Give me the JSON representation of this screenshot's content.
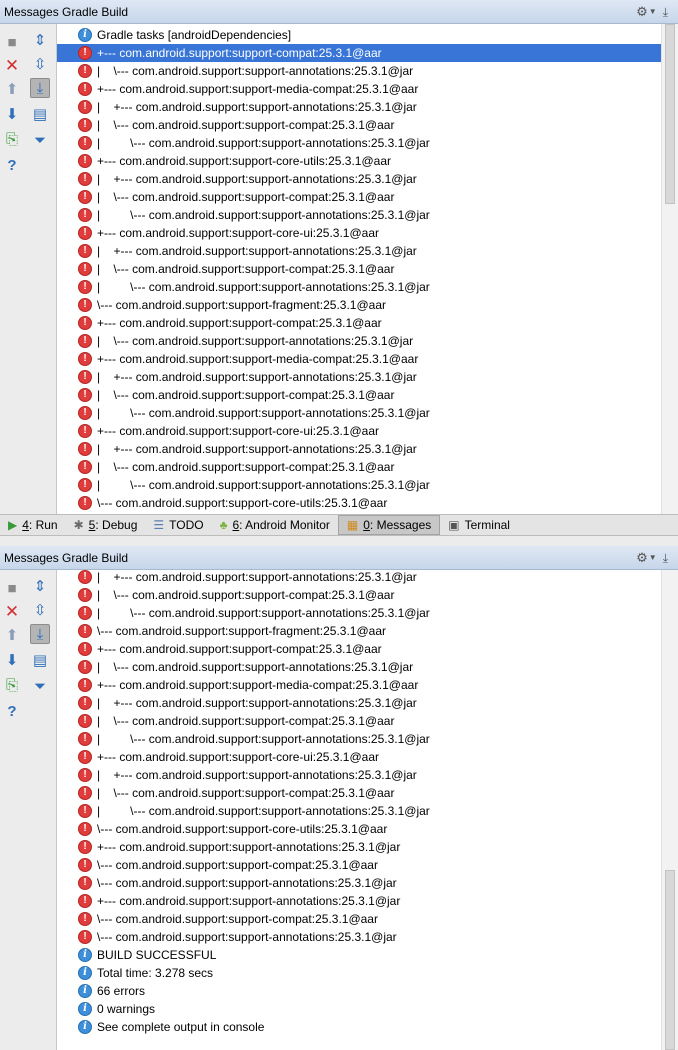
{
  "colors": {
    "selection": "#3875d7",
    "error": "#e03c3c",
    "info": "#3d8fd9"
  },
  "top_panel": {
    "title": "Messages Gradle Build",
    "rows": [
      {
        "icon": "info-icon",
        "text": "Gradle tasks [androidDependencies]"
      },
      {
        "icon": "error-icon",
        "text": "+--- com.android.support:support-compat:25.3.1@aar",
        "selected": true
      },
      {
        "icon": "error-icon",
        "text": "|    \\--- com.android.support:support-annotations:25.3.1@jar"
      },
      {
        "icon": "error-icon",
        "text": "+--- com.android.support:support-media-compat:25.3.1@aar"
      },
      {
        "icon": "error-icon",
        "text": "|    +--- com.android.support:support-annotations:25.3.1@jar"
      },
      {
        "icon": "error-icon",
        "text": "|    \\--- com.android.support:support-compat:25.3.1@aar"
      },
      {
        "icon": "error-icon",
        "text": "|         \\--- com.android.support:support-annotations:25.3.1@jar"
      },
      {
        "icon": "error-icon",
        "text": "+--- com.android.support:support-core-utils:25.3.1@aar"
      },
      {
        "icon": "error-icon",
        "text": "|    +--- com.android.support:support-annotations:25.3.1@jar"
      },
      {
        "icon": "error-icon",
        "text": "|    \\--- com.android.support:support-compat:25.3.1@aar"
      },
      {
        "icon": "error-icon",
        "text": "|         \\--- com.android.support:support-annotations:25.3.1@jar"
      },
      {
        "icon": "error-icon",
        "text": "+--- com.android.support:support-core-ui:25.3.1@aar"
      },
      {
        "icon": "error-icon",
        "text": "|    +--- com.android.support:support-annotations:25.3.1@jar"
      },
      {
        "icon": "error-icon",
        "text": "|    \\--- com.android.support:support-compat:25.3.1@aar"
      },
      {
        "icon": "error-icon",
        "text": "|         \\--- com.android.support:support-annotations:25.3.1@jar"
      },
      {
        "icon": "error-icon",
        "text": "\\--- com.android.support:support-fragment:25.3.1@aar"
      },
      {
        "icon": "error-icon",
        "text": "+--- com.android.support:support-compat:25.3.1@aar"
      },
      {
        "icon": "error-icon",
        "text": "|    \\--- com.android.support:support-annotations:25.3.1@jar"
      },
      {
        "icon": "error-icon",
        "text": "+--- com.android.support:support-media-compat:25.3.1@aar"
      },
      {
        "icon": "error-icon",
        "text": "|    +--- com.android.support:support-annotations:25.3.1@jar"
      },
      {
        "icon": "error-icon",
        "text": "|    \\--- com.android.support:support-compat:25.3.1@aar"
      },
      {
        "icon": "error-icon",
        "text": "|         \\--- com.android.support:support-annotations:25.3.1@jar"
      },
      {
        "icon": "error-icon",
        "text": "+--- com.android.support:support-core-ui:25.3.1@aar"
      },
      {
        "icon": "error-icon",
        "text": "|    +--- com.android.support:support-annotations:25.3.1@jar"
      },
      {
        "icon": "error-icon",
        "text": "|    \\--- com.android.support:support-compat:25.3.1@aar"
      },
      {
        "icon": "error-icon",
        "text": "|         \\--- com.android.support:support-annotations:25.3.1@jar"
      },
      {
        "icon": "error-icon",
        "text": "\\--- com.android.support:support-core-utils:25.3.1@aar"
      }
    ]
  },
  "tool_windows": [
    {
      "icon": "run-icon",
      "mnemonic": "4",
      "label": ": Run"
    },
    {
      "icon": "debug-icon",
      "mnemonic": "5",
      "label": ": Debug"
    },
    {
      "icon": "todo-icon",
      "mnemonic": "",
      "label": "TODO"
    },
    {
      "icon": "android-icon",
      "mnemonic": "6",
      "label": ": Android Monitor"
    },
    {
      "icon": "messages-icon",
      "mnemonic": "0",
      "label": ": Messages",
      "active": true
    },
    {
      "icon": "terminal-icon",
      "mnemonic": "",
      "label": "Terminal"
    }
  ],
  "bottom_panel": {
    "title": "Messages Gradle Build",
    "rows": [
      {
        "icon": "error-icon",
        "text": "|    +--- com.android.support:support-annotations:25.3.1@jar"
      },
      {
        "icon": "error-icon",
        "text": "|    \\--- com.android.support:support-compat:25.3.1@aar"
      },
      {
        "icon": "error-icon",
        "text": "|         \\--- com.android.support:support-annotations:25.3.1@jar"
      },
      {
        "icon": "error-icon",
        "text": "\\--- com.android.support:support-fragment:25.3.1@aar"
      },
      {
        "icon": "error-icon",
        "text": "+--- com.android.support:support-compat:25.3.1@aar"
      },
      {
        "icon": "error-icon",
        "text": "|    \\--- com.android.support:support-annotations:25.3.1@jar"
      },
      {
        "icon": "error-icon",
        "text": "+--- com.android.support:support-media-compat:25.3.1@aar"
      },
      {
        "icon": "error-icon",
        "text": "|    +--- com.android.support:support-annotations:25.3.1@jar"
      },
      {
        "icon": "error-icon",
        "text": "|    \\--- com.android.support:support-compat:25.3.1@aar"
      },
      {
        "icon": "error-icon",
        "text": "|         \\--- com.android.support:support-annotations:25.3.1@jar"
      },
      {
        "icon": "error-icon",
        "text": "+--- com.android.support:support-core-ui:25.3.1@aar"
      },
      {
        "icon": "error-icon",
        "text": "|    +--- com.android.support:support-annotations:25.3.1@jar"
      },
      {
        "icon": "error-icon",
        "text": "|    \\--- com.android.support:support-compat:25.3.1@aar"
      },
      {
        "icon": "error-icon",
        "text": "|         \\--- com.android.support:support-annotations:25.3.1@jar"
      },
      {
        "icon": "error-icon",
        "text": "\\--- com.android.support:support-core-utils:25.3.1@aar"
      },
      {
        "icon": "error-icon",
        "text": "+--- com.android.support:support-annotations:25.3.1@jar"
      },
      {
        "icon": "error-icon",
        "text": "\\--- com.android.support:support-compat:25.3.1@aar"
      },
      {
        "icon": "error-icon",
        "text": "\\--- com.android.support:support-annotations:25.3.1@jar"
      },
      {
        "icon": "error-icon",
        "text": "+--- com.android.support:support-annotations:25.3.1@jar"
      },
      {
        "icon": "error-icon",
        "text": "\\--- com.android.support:support-compat:25.3.1@aar"
      },
      {
        "icon": "error-icon",
        "text": "\\--- com.android.support:support-annotations:25.3.1@jar"
      },
      {
        "icon": "info-icon",
        "text": "BUILD SUCCESSFUL"
      },
      {
        "icon": "info-icon",
        "text": "Total time: 3.278 secs"
      },
      {
        "icon": "info-icon",
        "text": "66 errors"
      },
      {
        "icon": "info-icon",
        "text": "0 warnings"
      },
      {
        "icon": "info-icon",
        "text": "See complete output in console"
      }
    ]
  }
}
